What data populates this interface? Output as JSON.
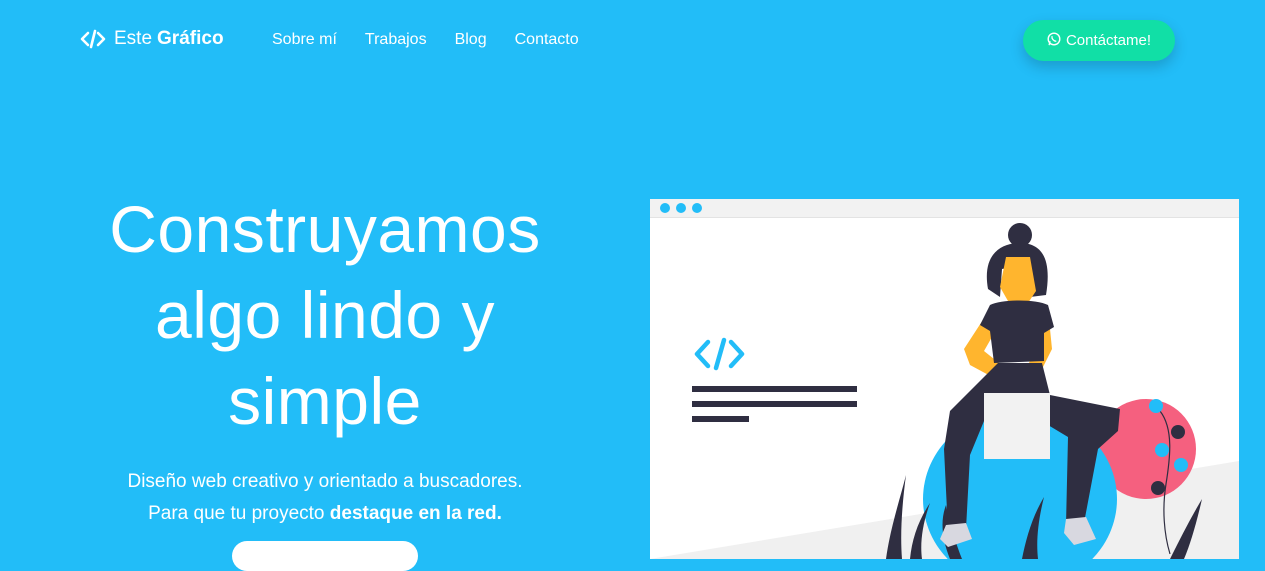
{
  "navbar": {
    "brand_light": "Este",
    "brand_bold": "Gráfico",
    "brand_icon": "code-icon",
    "links": [
      "Sobre mí",
      "Trabajos",
      "Blog",
      "Contacto"
    ],
    "cta_label": "Contáctame!",
    "cta_icon": "whatsapp-icon"
  },
  "hero": {
    "title_lines": [
      "Construyamos",
      "algo lindo y",
      "simple"
    ],
    "subtitle_line1": "Diseño web creativo y orientado a buscadores.",
    "subtitle_line2_prefix": "Para que tu proyecto ",
    "subtitle_line2_strong": "destaque en la red."
  },
  "colors": {
    "background": "#22bdf8",
    "cta": "#11dfa6",
    "accent_pink": "#f5607f",
    "figure_dark": "#2f2e41",
    "skin": "#ffb52e"
  }
}
